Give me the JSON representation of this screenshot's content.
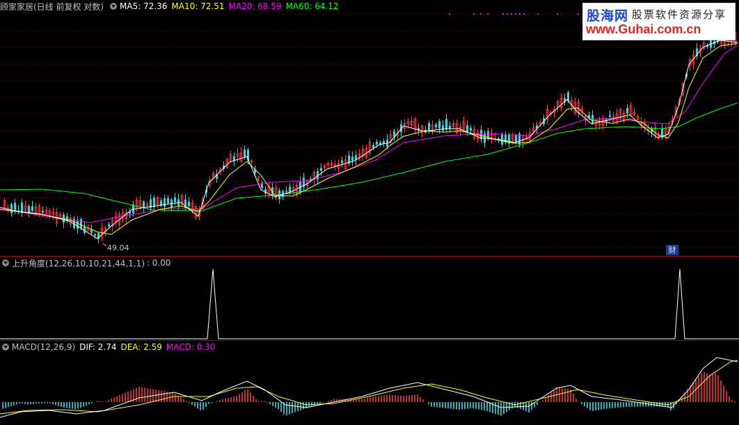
{
  "main": {
    "stock_title": "顾家家居(日线 前复权 对数)",
    "ma5_label": "MA5: 72.36",
    "ma10_label": "MA10: 72.51",
    "ma20_label": "MA20: 68.59",
    "ma60_label": "MA60: 64.12",
    "low_price_label": "49.04",
    "cai_marker": "财",
    "colors": {
      "ma5": "#ffffff",
      "ma10": "#ffff00",
      "ma20": "#ff00ff",
      "ma60": "#00ff00",
      "up": "#ff4040",
      "down": "#3cd2dc"
    }
  },
  "indicator": {
    "title": "上升角度(12,26,10,10,21,44,1,1)",
    "value_label": ": 0.00"
  },
  "macd": {
    "title": "MACD(12,26,9)",
    "dif_label": "DIF: 2.74",
    "dea_label": "DEA: 2.59",
    "macd_label": "MACD: 0.30"
  },
  "watermark": {
    "brand": "股海网",
    "tagline": "股票软件资源分享",
    "url": "www.Guhai.com.cn"
  }
}
